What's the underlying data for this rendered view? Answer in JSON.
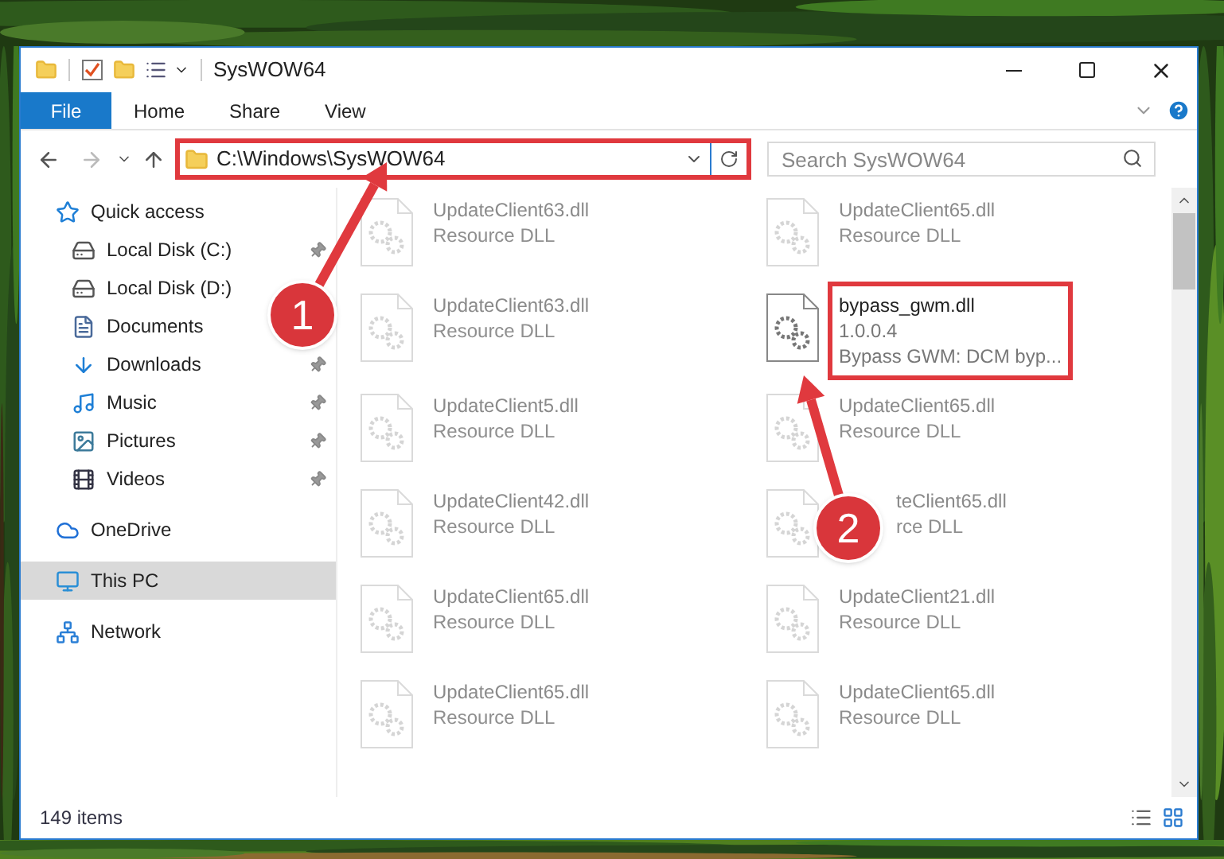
{
  "window": {
    "title": "SysWOW64"
  },
  "ribbon_tabs": [
    {
      "label": "File",
      "kind": "file"
    },
    {
      "label": "Home",
      "kind": "tab"
    },
    {
      "label": "Share",
      "kind": "tab"
    },
    {
      "label": "View",
      "kind": "tab"
    }
  ],
  "address_bar": {
    "path": "C:\\Windows\\SysWOW64",
    "marked": true
  },
  "search": {
    "placeholder": "Search SysWOW64"
  },
  "sidebar": {
    "items": [
      {
        "label": "Quick access",
        "selected": false,
        "children": [
          {
            "label": "Local Disk (C:)",
            "pinned": true,
            "selected": false
          },
          {
            "label": "Local Disk (D:)",
            "selected": false
          },
          {
            "label": "Documents",
            "selected": false
          },
          {
            "label": "Downloads",
            "pinned": true,
            "selected": false
          },
          {
            "label": "Music",
            "pinned": true,
            "selected": false
          },
          {
            "label": "Pictures",
            "pinned": true,
            "selected": false
          },
          {
            "label": "Videos",
            "pinned": true,
            "selected": false
          }
        ]
      },
      {
        "label": "OneDrive",
        "selected": false
      },
      {
        "label": "This PC",
        "selected": true
      },
      {
        "label": "Network",
        "selected": false
      }
    ]
  },
  "files": [
    {
      "name": "UpdateClient63.dll",
      "lines": [
        "Resource DLL"
      ],
      "blurred": true,
      "marked": false
    },
    {
      "name": "UpdateClient65.dll",
      "lines": [
        "Resource DLL"
      ],
      "blurred": true,
      "marked": false
    },
    {
      "name": "UpdateClient63.dll",
      "lines": [
        "Resource DLL"
      ],
      "blurred": true,
      "marked": false
    },
    {
      "name": "bypass_gwm.dll",
      "lines": [
        "1.0.0.4",
        "Bypass GWM: DCM byp..."
      ],
      "blurred": false,
      "marked": true
    },
    {
      "name": "UpdateClient5.dll",
      "lines": [
        "Resource DLL"
      ],
      "blurred": true,
      "marked": false
    },
    {
      "name": "UpdateClient65.dll",
      "lines": [
        "Resource DLL"
      ],
      "blurred": true,
      "marked": false
    },
    {
      "name": "UpdateClient42.dll",
      "lines": [
        "Resource DLL"
      ],
      "blurred": true,
      "marked": false
    },
    {
      "name": "teClient65.dll",
      "lines": [
        "rce DLL"
      ],
      "blurred": true,
      "marked": false,
      "covered": true
    },
    {
      "name": "UpdateClient65.dll",
      "lines": [
        "Resource DLL"
      ],
      "blurred": true,
      "marked": false
    },
    {
      "name": "UpdateClient21.dll",
      "lines": [
        "Resource DLL"
      ],
      "blurred": true,
      "marked": false
    },
    {
      "name": "UpdateClient65.dll",
      "lines": [
        "Resource DLL"
      ],
      "blurred": true,
      "marked": false
    },
    {
      "name": "UpdateClient65.dll",
      "lines": [
        "Resource DLL"
      ],
      "blurred": true,
      "marked": false
    }
  ],
  "status_bar": {
    "count": "149 items"
  },
  "annotations": [
    {
      "label": "1"
    },
    {
      "label": "2"
    }
  ]
}
